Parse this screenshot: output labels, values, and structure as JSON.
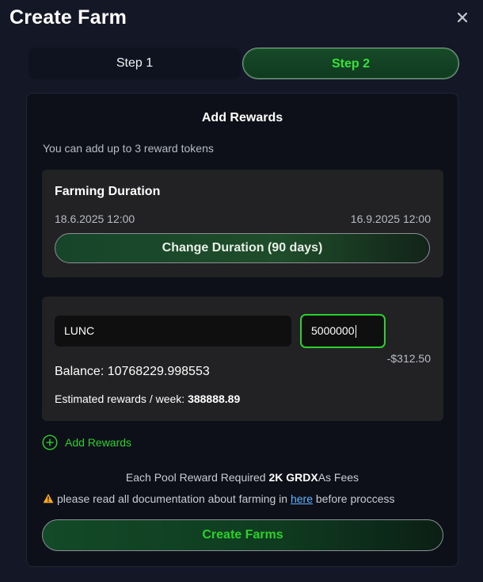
{
  "modal": {
    "title": "Create Farm",
    "close_icon": "close-icon"
  },
  "steps": [
    {
      "label": "Step 1",
      "active": false
    },
    {
      "label": "Step 2",
      "active": true
    }
  ],
  "panel": {
    "title": "Add Rewards",
    "subtitle": "You can add up to 3 reward tokens"
  },
  "duration": {
    "title": "Farming Duration",
    "start": "18.6.2025 12:00",
    "end": "16.9.2025 12:00",
    "button_label": "Change Duration (90 days)"
  },
  "reward": {
    "token": "LUNC",
    "amount": "5000000",
    "usd_value": "-$312.50",
    "balance": "Balance: 10768229.998553",
    "estimated_label": "Estimated rewards / week:",
    "estimated_value": "388888.89"
  },
  "add_rewards": {
    "label": "Add Rewards",
    "icon": "plus-circle-icon"
  },
  "fee_note": {
    "prefix": "Each Pool Reward Required",
    "amount": "2K GRDX",
    "suffix": "As Fees"
  },
  "docs_note": {
    "icon": "warning-icon",
    "prefix": "please read all documentation about farming in",
    "link": "here",
    "suffix": "before proccess"
  },
  "create_button": {
    "label": "Create Farms"
  },
  "colors": {
    "accent_green": "#2ad12b",
    "background": "#141826",
    "panel": "#0d1019",
    "card": "#222224",
    "link": "#5fb4ff",
    "warning": "#f5a623"
  }
}
